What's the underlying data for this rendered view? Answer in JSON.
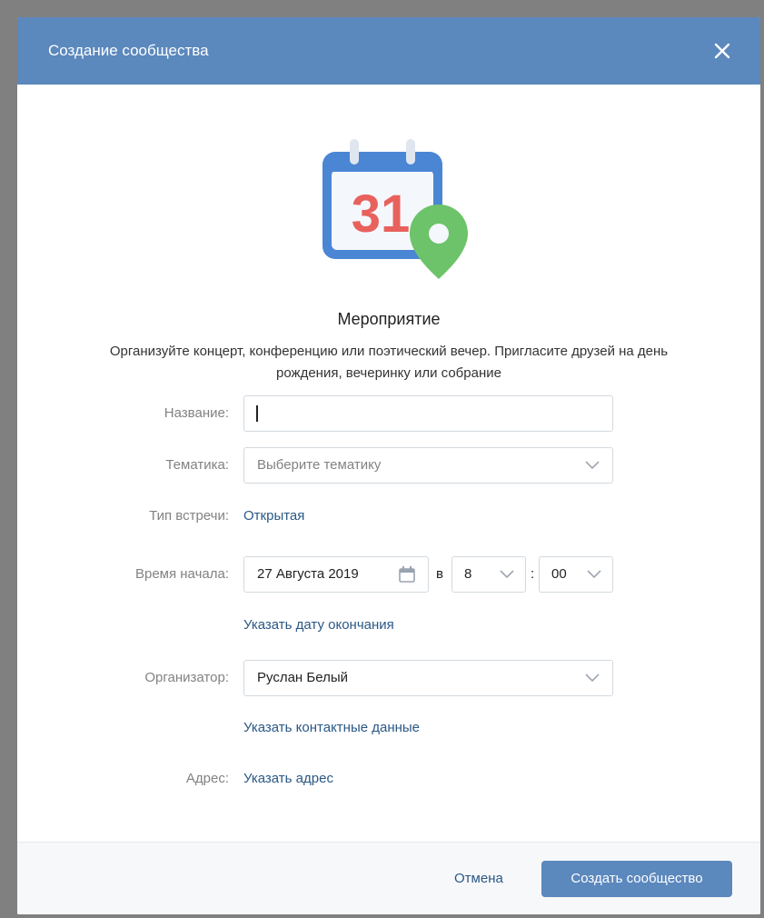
{
  "modal": {
    "title": "Создание сообщества"
  },
  "hero": {
    "icon": "calendar-pin-icon",
    "calendar_number": "31",
    "title": "Мероприятие",
    "description": "Организуйте концерт, конференцию или поэтический вечер. Пригласите друзей на день рождения, вечеринку или собрание"
  },
  "form": {
    "name": {
      "label": "Название:",
      "value": ""
    },
    "topic": {
      "label": "Тематика:",
      "placeholder": "Выберите тематику"
    },
    "meeting_type": {
      "label": "Тип встречи:",
      "value": "Открытая"
    },
    "start_time": {
      "label": "Время начала:",
      "date": "27 Августа 2019",
      "at": "в",
      "hour": "8",
      "colon": ":",
      "minute": "00",
      "end_date_link": "Указать дату окончания"
    },
    "organizer": {
      "label": "Организатор:",
      "value": "Руслан Белый",
      "contacts_link": "Указать контактные данные"
    },
    "address": {
      "label": "Адрес:",
      "link": "Указать адрес"
    }
  },
  "footer": {
    "cancel_label": "Отмена",
    "create_label": "Создать сообщество"
  },
  "colors": {
    "header": "#5b88bd",
    "link": "#2a5885",
    "button": "#5b88bd",
    "calendar_blue": "#4a86d4",
    "calendar_red": "#e8615d",
    "pin_green": "#6cc36a"
  }
}
